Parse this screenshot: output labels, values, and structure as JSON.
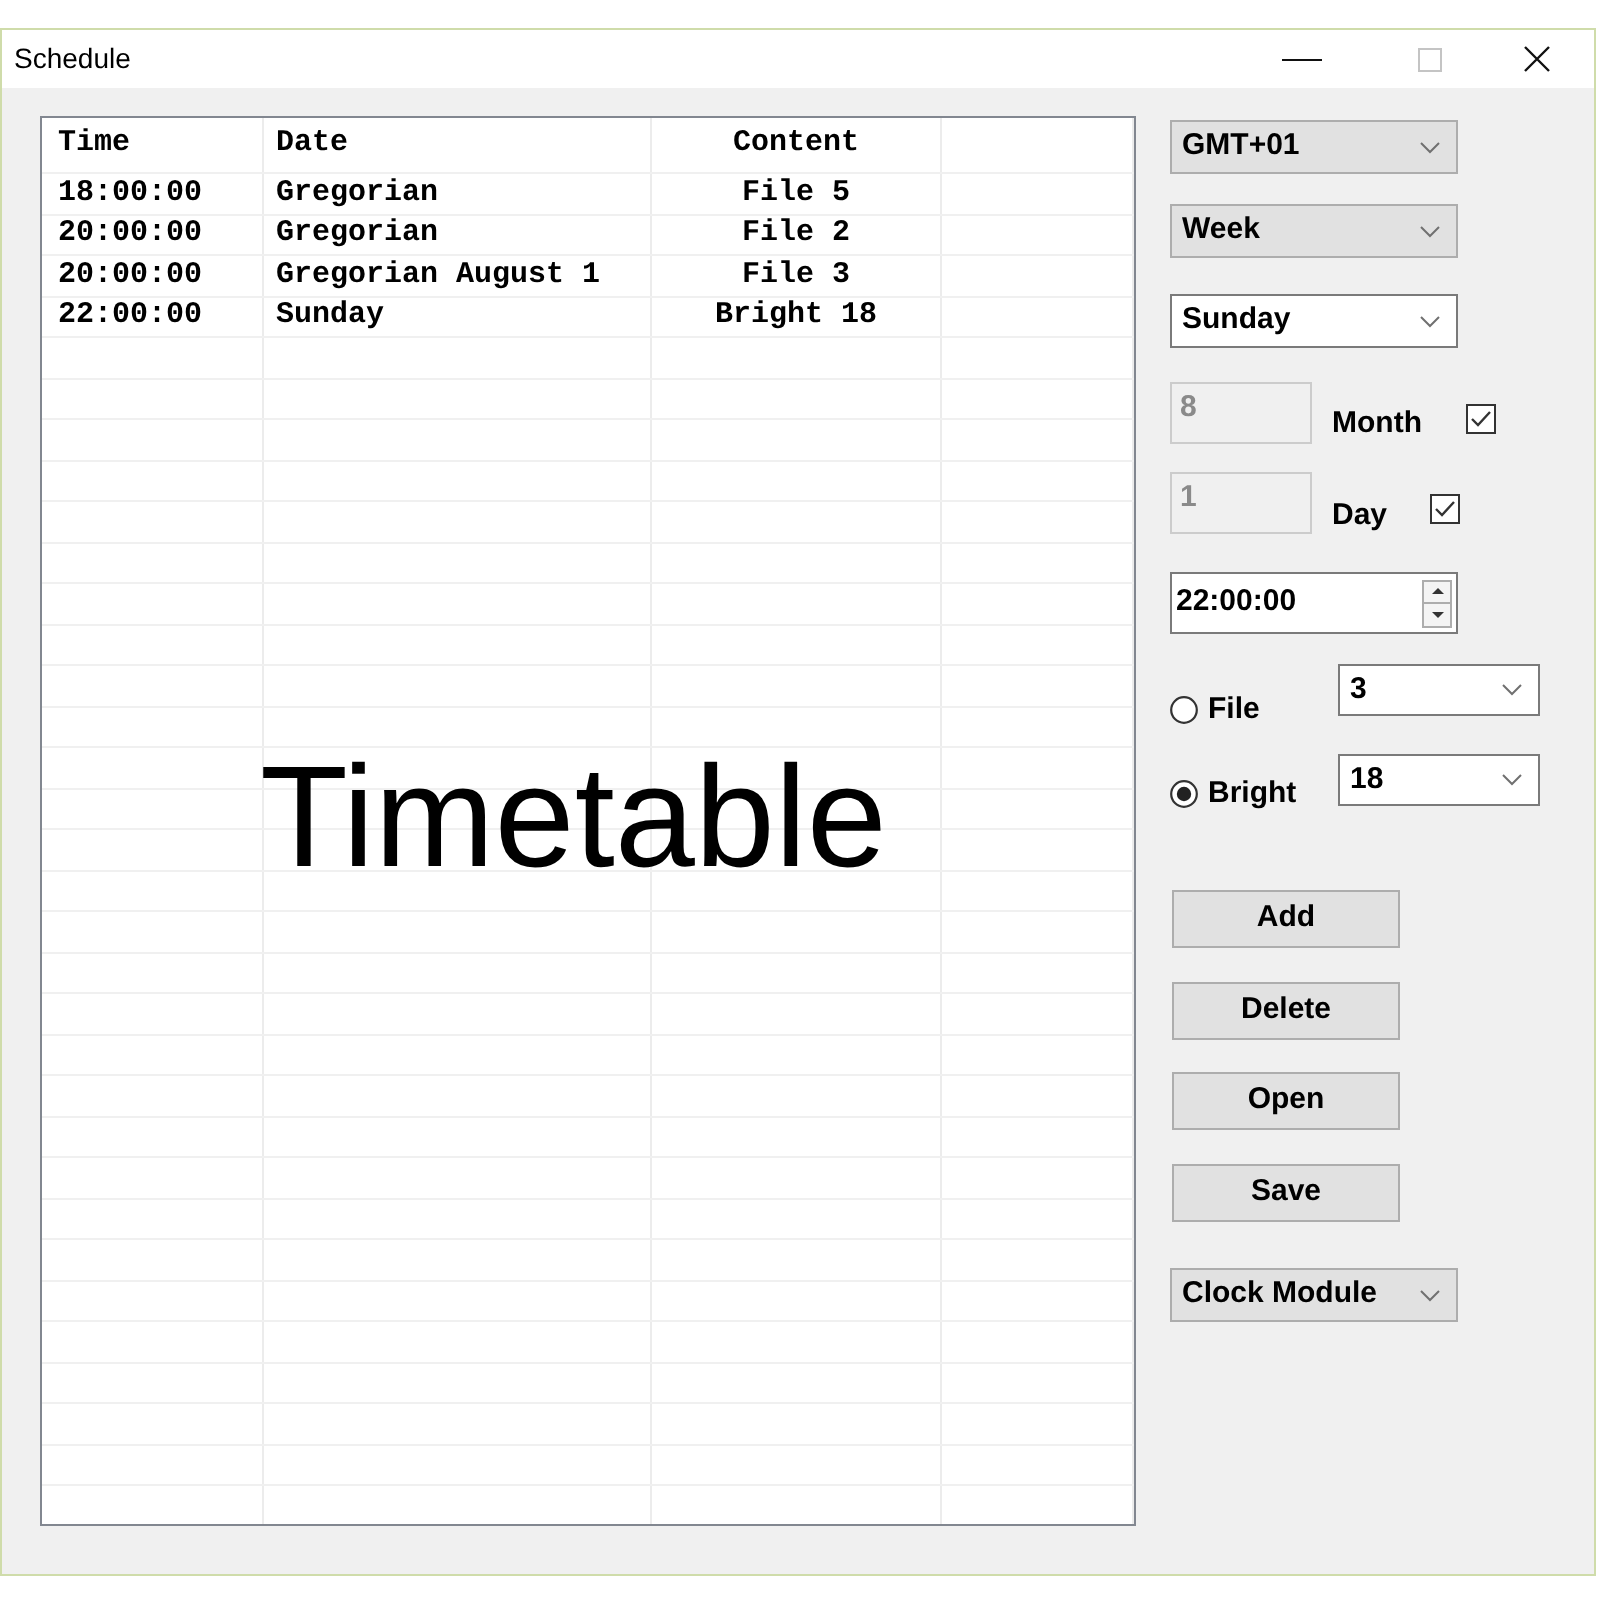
{
  "window": {
    "title": "Schedule"
  },
  "timetable": {
    "columns": [
      "Time",
      "Date",
      "Content"
    ],
    "rows": [
      [
        "18:00:00",
        "Gregorian",
        "File 5"
      ],
      [
        "20:00:00",
        "Gregorian",
        "File 2"
      ],
      [
        "20:00:00",
        "Gregorian August 1",
        "File 3"
      ],
      [
        "22:00:00",
        "Sunday",
        "Bright 18"
      ]
    ],
    "caption": "Timetable"
  },
  "settings": {
    "timezone": "GMT+01",
    "repeat": "Week",
    "weekday": "Sunday",
    "month": {
      "value": "8",
      "disabled": true,
      "label": "Month",
      "checked": true
    },
    "day": {
      "value": "1",
      "disabled": true,
      "label": "Day",
      "checked": true
    },
    "time": "22:00:00",
    "source": [
      {
        "label": "File",
        "selected": false,
        "value": "3"
      },
      {
        "label": "Bright",
        "selected": true,
        "value": "18"
      }
    ]
  },
  "buttons": [
    "Add",
    "Delete",
    "Open",
    "Save"
  ],
  "module": "Clock Module"
}
